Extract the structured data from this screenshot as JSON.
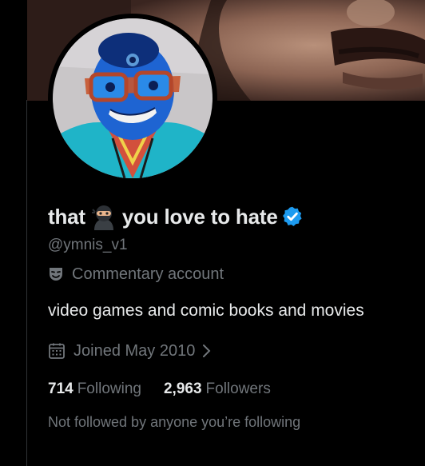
{
  "profile": {
    "name_part1": "that",
    "name_emoji": "ninja-emoji",
    "name_part2": "you love to hate",
    "verified_badge": "verified-badge-icon",
    "handle": "@ymnis_v1",
    "category": "Commentary account",
    "category_icon": "theater-masks-icon",
    "bio": "video games and comic books and movies",
    "joined": "Joined May 2010",
    "joined_icon": "calendar-icon",
    "following_count": "714",
    "following_label": "Following",
    "followers_count": "2,963",
    "followers_label": "Followers",
    "mutuals_text": "Not followed by anyone you’re following"
  },
  "colors": {
    "background": "#000000",
    "primary_text": "#e7e9ea",
    "secondary_text": "#71767b",
    "verified_blue": "#1d9bf0",
    "divider": "#2f3336"
  }
}
